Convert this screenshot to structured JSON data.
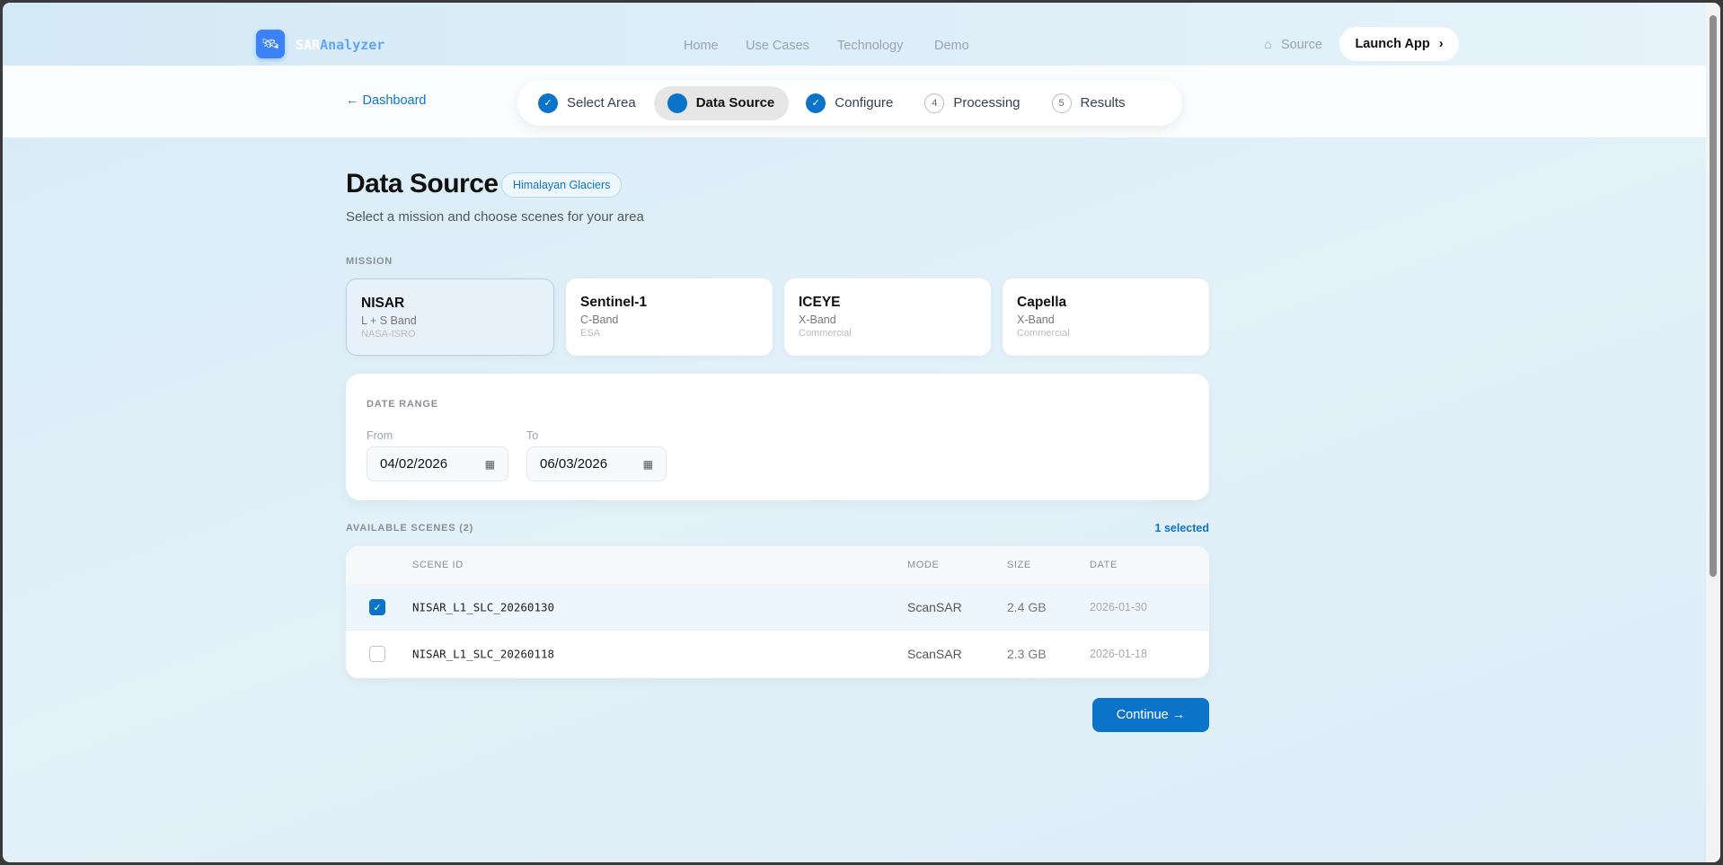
{
  "header": {
    "brand_a": "SAR",
    "brand_b": "Analyzer",
    "nav": [
      "Home",
      "Use Cases",
      "Technology",
      "Demo"
    ],
    "source": "Source",
    "launch": "Launch App"
  },
  "subnav": {
    "back": "← Dashboard",
    "steps": [
      {
        "mark": "✓",
        "label": "Select Area",
        "state": "done"
      },
      {
        "mark": "",
        "label": "Data Source",
        "state": "current"
      },
      {
        "mark": "✓",
        "label": "Configure",
        "state": "done"
      },
      {
        "mark": "4",
        "label": "Processing",
        "state": "todo"
      },
      {
        "mark": "5",
        "label": "Results",
        "state": "todo"
      }
    ]
  },
  "page": {
    "title": "Data Source",
    "badge": "Himalayan Glaciers",
    "subtitle": "Select a mission and choose scenes for your area"
  },
  "mission": {
    "label": "MISSION",
    "cards": [
      {
        "name": "NISAR",
        "band": "L + S Band",
        "org": "NASA-ISRO"
      },
      {
        "name": "Sentinel-1",
        "band": "C-Band",
        "org": "ESA"
      },
      {
        "name": "ICEYE",
        "band": "X-Band",
        "org": "Commercial"
      },
      {
        "name": "Capella",
        "band": "X-Band",
        "org": "Commercial"
      }
    ]
  },
  "date_range": {
    "label": "DATE RANGE",
    "from_label": "From",
    "from": "04/02/2026",
    "to_label": "To",
    "to": "06/03/2026"
  },
  "scenes": {
    "label": "AVAILABLE SCENES (2)",
    "selected": "1 selected",
    "headers": [
      "SCENE ID",
      "MODE",
      "SIZE",
      "DATE"
    ],
    "rows": [
      {
        "id": "NISAR_L1_SLC_20260130",
        "mode": "ScanSAR",
        "size": "2.4 GB",
        "date": "2026-01-30",
        "checked": true
      },
      {
        "id": "NISAR_L1_SLC_20260118",
        "mode": "ScanSAR",
        "size": "2.3 GB",
        "date": "2026-01-18",
        "checked": false
      }
    ]
  },
  "continue": "Continue →"
}
